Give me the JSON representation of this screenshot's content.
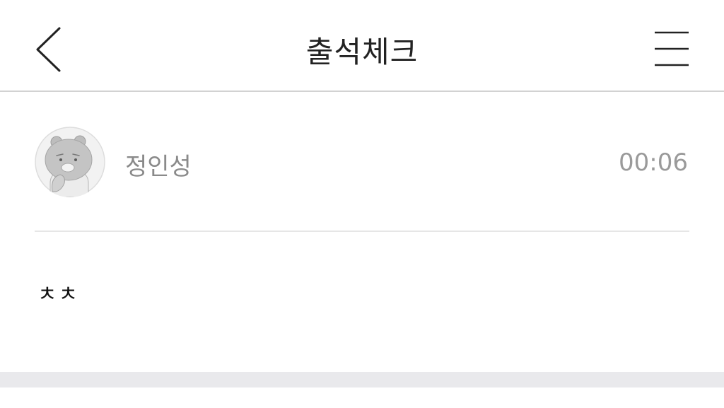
{
  "header": {
    "title": "출석체크",
    "back_icon": "chevron-left-icon",
    "menu_icon": "hamburger-menu-icon"
  },
  "post": {
    "author": "정인성",
    "time": "00:06",
    "avatar_icon": "bear-character-avatar",
    "body": "ㅊㅊ"
  },
  "colors": {
    "title": "#222222",
    "meta_text": "#8a8a8a",
    "divider": "#e6e6e6",
    "bottom_band": "#e9e9ec"
  }
}
